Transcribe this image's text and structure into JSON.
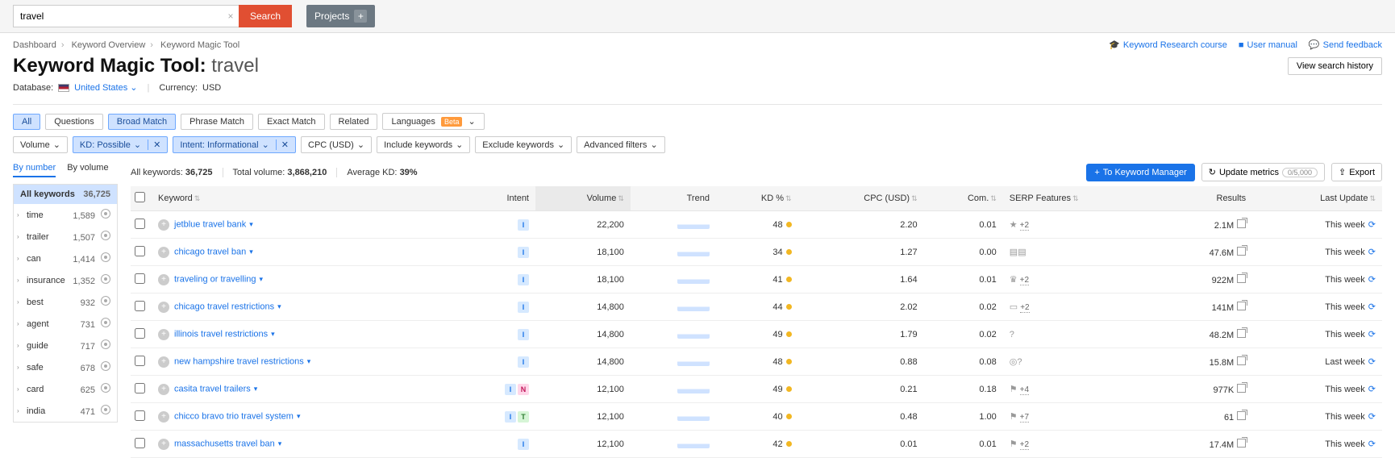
{
  "search": {
    "value": "travel",
    "button": "Search",
    "projects": "Projects"
  },
  "breadcrumb": [
    "Dashboard",
    "Keyword Overview",
    "Keyword Magic Tool"
  ],
  "help_links": {
    "research": "Keyword Research course",
    "manual": "User manual",
    "feedback": "Send feedback"
  },
  "title": {
    "tool": "Keyword Magic Tool:",
    "kw": "travel",
    "history_btn": "View search history"
  },
  "db": {
    "label": "Database:",
    "country": "United States",
    "currency_label": "Currency:",
    "currency": "USD"
  },
  "match_pills": [
    "All",
    "Questions",
    "Broad Match",
    "Phrase Match",
    "Exact Match",
    "Related"
  ],
  "match_active_idx": 2,
  "all_active": true,
  "languages_label": "Languages",
  "beta_label": "Beta",
  "filters": {
    "volume": "Volume",
    "kd": "KD: Possible",
    "intent": "Intent: Informational",
    "cpc": "CPC (USD)",
    "include": "Include keywords",
    "exclude": "Exclude keywords",
    "advanced": "Advanced filters"
  },
  "left_tabs": {
    "number": "By number",
    "volume": "By volume"
  },
  "groups_header": {
    "label": "All keywords",
    "count": "36,725"
  },
  "groups": [
    {
      "name": "time",
      "count": "1,589"
    },
    {
      "name": "trailer",
      "count": "1,507"
    },
    {
      "name": "can",
      "count": "1,414"
    },
    {
      "name": "insurance",
      "count": "1,352"
    },
    {
      "name": "best",
      "count": "932"
    },
    {
      "name": "agent",
      "count": "731"
    },
    {
      "name": "guide",
      "count": "717"
    },
    {
      "name": "safe",
      "count": "678"
    },
    {
      "name": "card",
      "count": "625"
    },
    {
      "name": "india",
      "count": "471"
    }
  ],
  "stats": {
    "all_label": "All keywords:",
    "all_val": "36,725",
    "vol_label": "Total volume:",
    "vol_val": "3,868,210",
    "kd_label": "Average KD:",
    "kd_val": "39%"
  },
  "actions": {
    "km": "To Keyword Manager",
    "update": "Update metrics",
    "update_count": "0/5,000",
    "export": "Export"
  },
  "columns": {
    "keyword": "Keyword",
    "intent": "Intent",
    "volume": "Volume",
    "trend": "Trend",
    "kd": "KD %",
    "cpc": "CPC (USD)",
    "com": "Com.",
    "serp": "SERP Features",
    "results": "Results",
    "last": "Last Update"
  },
  "rows": [
    {
      "kw": "jetblue travel bank",
      "intent": [
        "I"
      ],
      "volume": "22,200",
      "kd": "48",
      "cpc": "2.20",
      "com": "0.01",
      "serp": "★",
      "serp_more": "+2",
      "results": "2.1M",
      "last": "This week"
    },
    {
      "kw": "chicago travel ban",
      "intent": [
        "I"
      ],
      "volume": "18,100",
      "kd": "34",
      "cpc": "1.27",
      "com": "0.00",
      "serp": "▤▤",
      "serp_more": "",
      "results": "47.6M",
      "last": "This week"
    },
    {
      "kw": "traveling or travelling",
      "intent": [
        "I"
      ],
      "volume": "18,100",
      "kd": "41",
      "cpc": "1.64",
      "com": "0.01",
      "serp": "♛",
      "serp_more": "+2",
      "results": "922M",
      "last": "This week"
    },
    {
      "kw": "chicago travel restrictions",
      "intent": [
        "I"
      ],
      "volume": "14,800",
      "kd": "44",
      "cpc": "2.02",
      "com": "0.02",
      "serp": "▭",
      "serp_more": "+2",
      "results": "141M",
      "last": "This week"
    },
    {
      "kw": "illinois travel restrictions",
      "intent": [
        "I"
      ],
      "volume": "14,800",
      "kd": "49",
      "cpc": "1.79",
      "com": "0.02",
      "serp": "?",
      "serp_more": "",
      "results": "48.2M",
      "last": "This week"
    },
    {
      "kw": "new hampshire travel restrictions",
      "intent": [
        "I"
      ],
      "volume": "14,800",
      "kd": "48",
      "cpc": "0.88",
      "com": "0.08",
      "serp": "◎?",
      "serp_more": "",
      "results": "15.8M",
      "last": "Last week"
    },
    {
      "kw": "casita travel trailers",
      "intent": [
        "I",
        "N"
      ],
      "volume": "12,100",
      "kd": "49",
      "cpc": "0.21",
      "com": "0.18",
      "serp": "⚑",
      "serp_more": "+4",
      "results": "977K",
      "last": "This week"
    },
    {
      "kw": "chicco bravo trio travel system",
      "intent": [
        "I",
        "T"
      ],
      "volume": "12,100",
      "kd": "40",
      "cpc": "0.48",
      "com": "1.00",
      "serp": "⚑",
      "serp_more": "+7",
      "results": "61",
      "last": "This week"
    },
    {
      "kw": "massachusetts travel ban",
      "intent": [
        "I"
      ],
      "volume": "12,100",
      "kd": "42",
      "cpc": "0.01",
      "com": "0.01",
      "serp": "⚑",
      "serp_more": "+2",
      "results": "17.4M",
      "last": "This week"
    }
  ]
}
